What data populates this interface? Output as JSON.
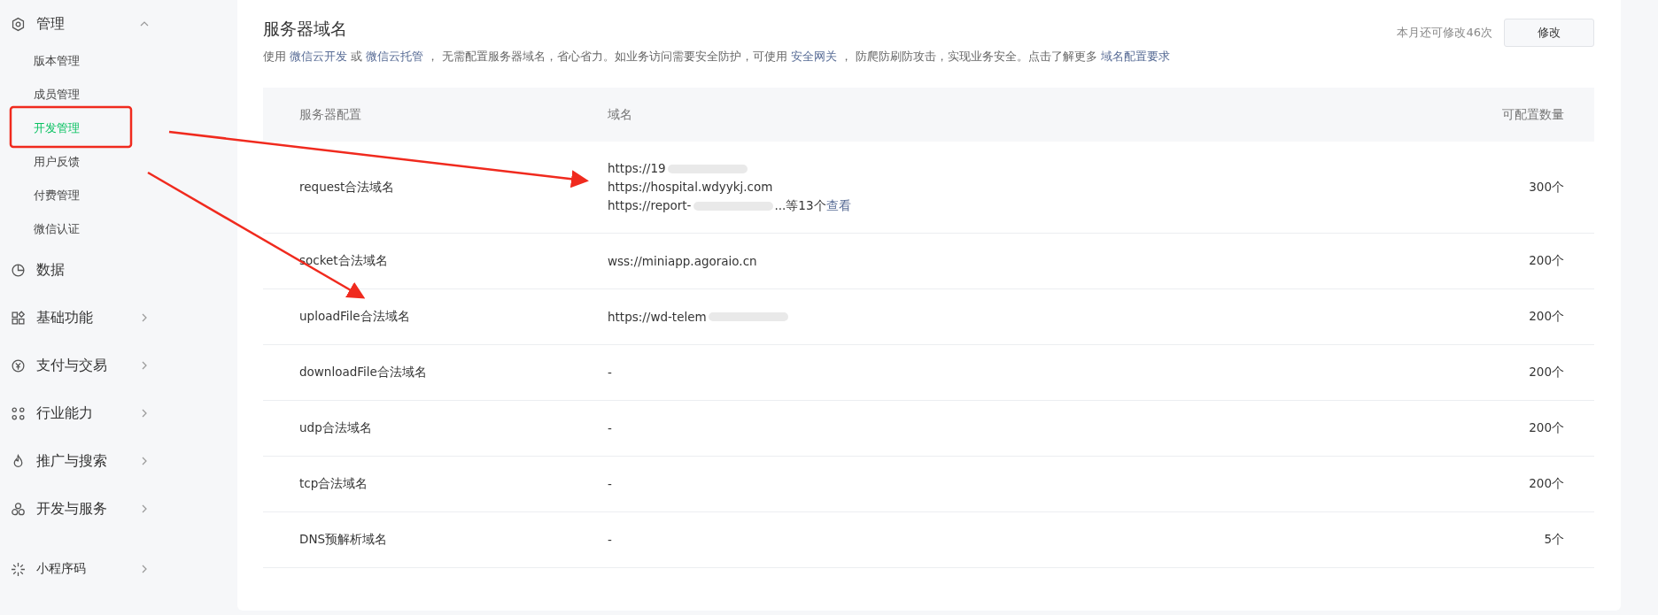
{
  "sidebar": {
    "items": [
      {
        "label": "管理",
        "expanded": true,
        "children": [
          {
            "label": "版本管理",
            "selected": false
          },
          {
            "label": "成员管理",
            "selected": false
          },
          {
            "label": "开发管理",
            "selected": true
          },
          {
            "label": "用户反馈",
            "selected": false
          },
          {
            "label": "付费管理",
            "selected": false
          },
          {
            "label": "微信认证",
            "selected": false
          }
        ]
      },
      {
        "label": "数据"
      },
      {
        "label": "基础功能",
        "expanded": false
      },
      {
        "label": "支付与交易",
        "expanded": false
      },
      {
        "label": "行业能力",
        "expanded": false
      },
      {
        "label": "推广与搜索",
        "expanded": false
      },
      {
        "label": "开发与服务",
        "expanded": false
      }
    ],
    "footer_item": {
      "label": "小程序码",
      "expanded": false
    }
  },
  "section": {
    "title": "服务器域名",
    "description": [
      {
        "text": "使用 "
      },
      {
        "text": "微信云开发",
        "link": true
      },
      {
        "text": " 或 "
      },
      {
        "text": "微信云托管",
        "link": true
      },
      {
        "text": " ， 无需配置服务器域名，省心省力。如业务访问需要安全防护，可使用 "
      },
      {
        "text": "安全网关",
        "link": true
      },
      {
        "text": " ， 防爬防刷防攻击，实现业务安全。点击了解更多 "
      },
      {
        "text": "域名配置要求",
        "link": true
      }
    ],
    "remaining": "本月还可修改46次",
    "edit_button": "修改"
  },
  "table": {
    "columns": [
      "服务器配置",
      "域名",
      "可配置数量"
    ],
    "rows": [
      {
        "name": "request合法域名",
        "domains": [
          "https://19",
          "https://hospital.wdyykj.com",
          "https://report-"
        ],
        "more": "...等13个",
        "more_link": "查看",
        "count": "300个"
      },
      {
        "name": "socket合法域名",
        "domains": [
          "wss://miniapp.agoraio.cn"
        ],
        "count": "200个"
      },
      {
        "name": "uploadFile合法域名",
        "domains": [
          "https://wd-telem"
        ],
        "count": "200个"
      },
      {
        "name": "downloadFile合法域名",
        "domains": [
          "-"
        ],
        "count": "200个"
      },
      {
        "name": "udp合法域名",
        "domains": [
          "-"
        ],
        "count": "200个"
      },
      {
        "name": "tcp合法域名",
        "domains": [
          "-"
        ],
        "count": "200个"
      },
      {
        "name": "DNS预解析域名",
        "domains": [
          "-"
        ],
        "count": "5个"
      }
    ]
  }
}
